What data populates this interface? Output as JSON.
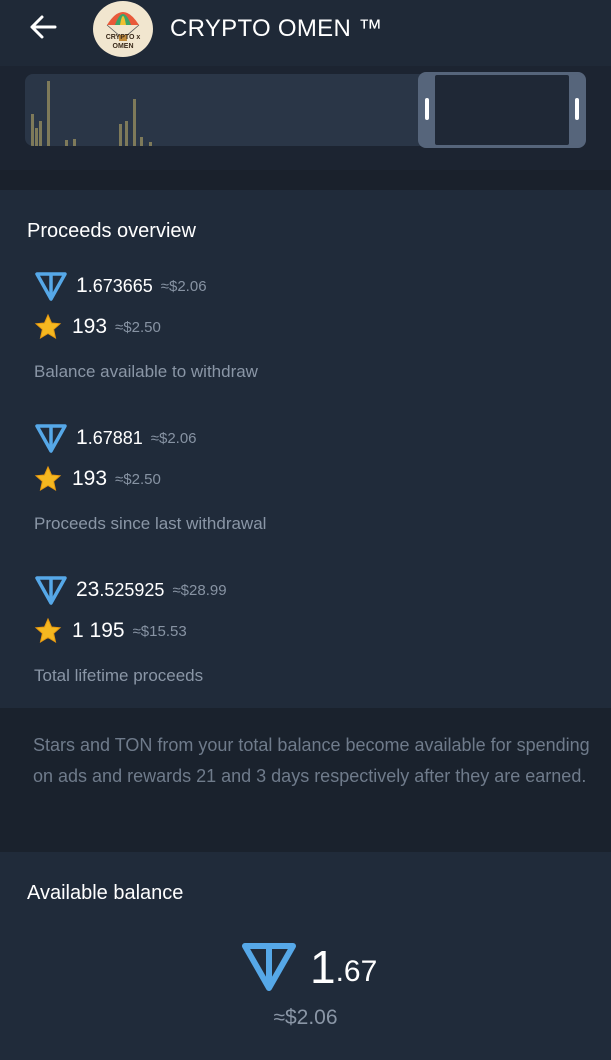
{
  "header": {
    "title": "CRYPTO OMEN ™",
    "avatar_text_line1": "CRYPTO x",
    "avatar_text_line2": "OMEN",
    "back_icon": "arrow-left-icon"
  },
  "mini_chart": {
    "bar_heights": [
      0.45,
      0.9,
      0.35,
      0.25,
      0.08,
      0.1,
      0.3,
      0.65,
      0.35,
      0.12,
      0.06
    ]
  },
  "proceeds": {
    "title": "Proceeds overview",
    "groups": [
      {
        "ton_int": "1",
        "ton_frac": ".673665",
        "ton_usd": "≈$2.06",
        "stars": "193",
        "stars_usd": "≈$2.50",
        "caption": "Balance available to withdraw"
      },
      {
        "ton_int": "1",
        "ton_frac": ".67881",
        "ton_usd": "≈$2.06",
        "stars": "193",
        "stars_usd": "≈$2.50",
        "caption": "Proceeds since last withdrawal"
      },
      {
        "ton_int": "23",
        "ton_frac": ".525925",
        "ton_usd": "≈$28.99",
        "stars": "1 195",
        "stars_usd": "≈$15.53",
        "caption": "Total lifetime proceeds"
      }
    ]
  },
  "info": {
    "text": "Stars and TON from your total balance become available for spending on ads and rewards 21 and 3 days respectively after they are earned."
  },
  "balance": {
    "title": "Available balance",
    "int": "1",
    "frac": ".67",
    "usd": "≈$2.06"
  },
  "colors": {
    "ton": "#56a8e8",
    "star": "#f5b820",
    "bg": "#202b3a"
  }
}
